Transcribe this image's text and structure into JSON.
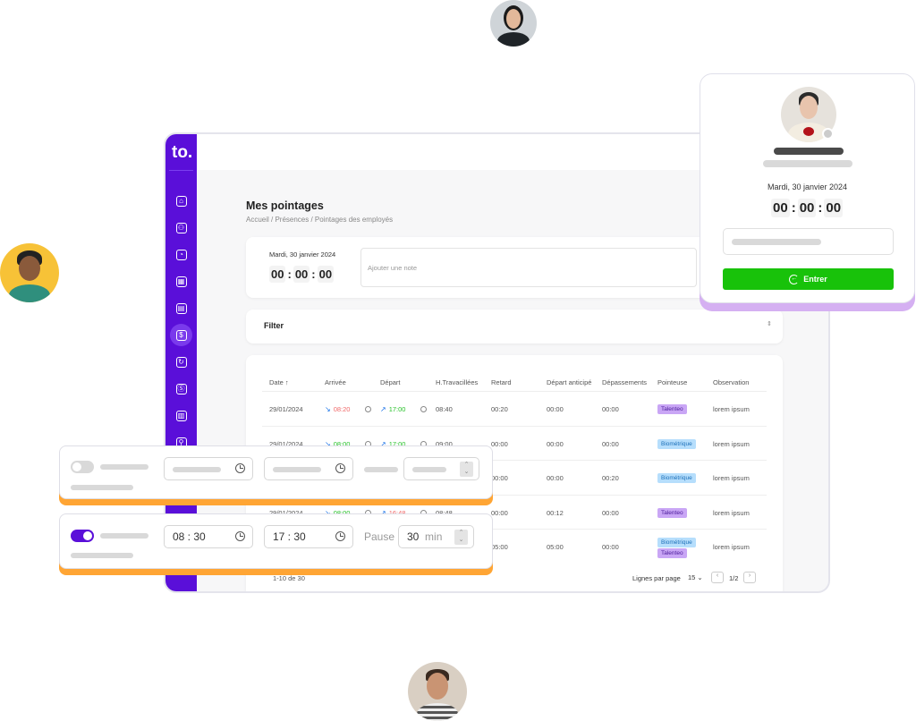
{
  "app": {
    "logo": "to."
  },
  "sidebar": {
    "items": [
      {
        "icon": "home-icon"
      },
      {
        "icon": "users-icon"
      },
      {
        "icon": "clock-icon"
      },
      {
        "icon": "calendar-icon"
      },
      {
        "icon": "document-icon"
      },
      {
        "icon": "dollar-icon",
        "active": true
      },
      {
        "icon": "refresh-icon"
      },
      {
        "icon": "coin-icon"
      },
      {
        "icon": "building-icon"
      },
      {
        "icon": "org-chart-icon"
      }
    ],
    "accent": "#5a0fd9"
  },
  "page": {
    "title": "Mes pointages",
    "breadcrumb": "Accueil / Présences / Pointages des employés"
  },
  "clock_card": {
    "date": "Mardi, 30 janvier 2024",
    "h": "00",
    "m": "00",
    "s": "00",
    "note_placeholder": "Ajouter une note"
  },
  "filter": {
    "label": "Filter"
  },
  "table": {
    "headers": [
      "Date ↑",
      "Arrivée",
      "Départ",
      "H.Travacillées",
      "Retard",
      "Départ anticipé",
      "Dépassements",
      "Pointeuse",
      "Observation"
    ],
    "rows": [
      {
        "date": "29/01/2024",
        "arrivee": "08:20",
        "arrivee_status": "late",
        "depart": "17:00",
        "depart_status": "ok",
        "h": "08:40",
        "retard": "00:20",
        "da": "00:00",
        "dep": "00:00",
        "pointeuse": [
          "Talenteo"
        ],
        "obs": "lorem ipsum"
      },
      {
        "date": "29/01/2024",
        "arrivee": "08:00",
        "arrivee_status": "ok",
        "depart": "17:00",
        "depart_status": "ok",
        "h": "09:00",
        "retard": "00:00",
        "da": "00:00",
        "dep": "00:00",
        "pointeuse": [
          "Biométrique"
        ],
        "obs": "lorem ipsum"
      },
      {
        "date": "",
        "arrivee": "",
        "depart": "",
        "h": "",
        "retard": "00:00",
        "da": "00:00",
        "dep": "00:20",
        "pointeuse": [
          "Biométrique"
        ],
        "obs": "lorem ipsum"
      },
      {
        "date": "29/01/2024",
        "arrivee": "08:00",
        "arrivee_status": "ok",
        "depart": "16:48",
        "depart_status": "early",
        "h": "08:48",
        "retard": "00:00",
        "da": "00:12",
        "dep": "00:00",
        "pointeuse": [
          "Talenteo"
        ],
        "obs": "lorem ipsum"
      },
      {
        "date": "",
        "arrivee": "",
        "depart": "",
        "h": "",
        "retard": "05:00",
        "da": "05:00",
        "dep": "00:00",
        "pointeuse": [
          "Biométrique",
          "Talenteo"
        ],
        "obs": "lorem ipsum"
      }
    ],
    "footer": {
      "range": "1-10 de 30",
      "rows_per_page_label": "Lignes par page",
      "rows_per_page": "15",
      "page": "1/2"
    }
  },
  "schedule": {
    "disabled_row": {
      "toggle": false
    },
    "active_row": {
      "toggle": true,
      "start": "08 : 30",
      "end": "17 : 30",
      "pause_label": "Pause",
      "pause_value": "30",
      "pause_unit": "min"
    },
    "accent": "#ffa534"
  },
  "checkin_card": {
    "date": "Mardi, 30 janvier 2024",
    "h": "00",
    "m": "00",
    "s": "00",
    "button": "Entrer",
    "button_color": "#18c20a"
  }
}
